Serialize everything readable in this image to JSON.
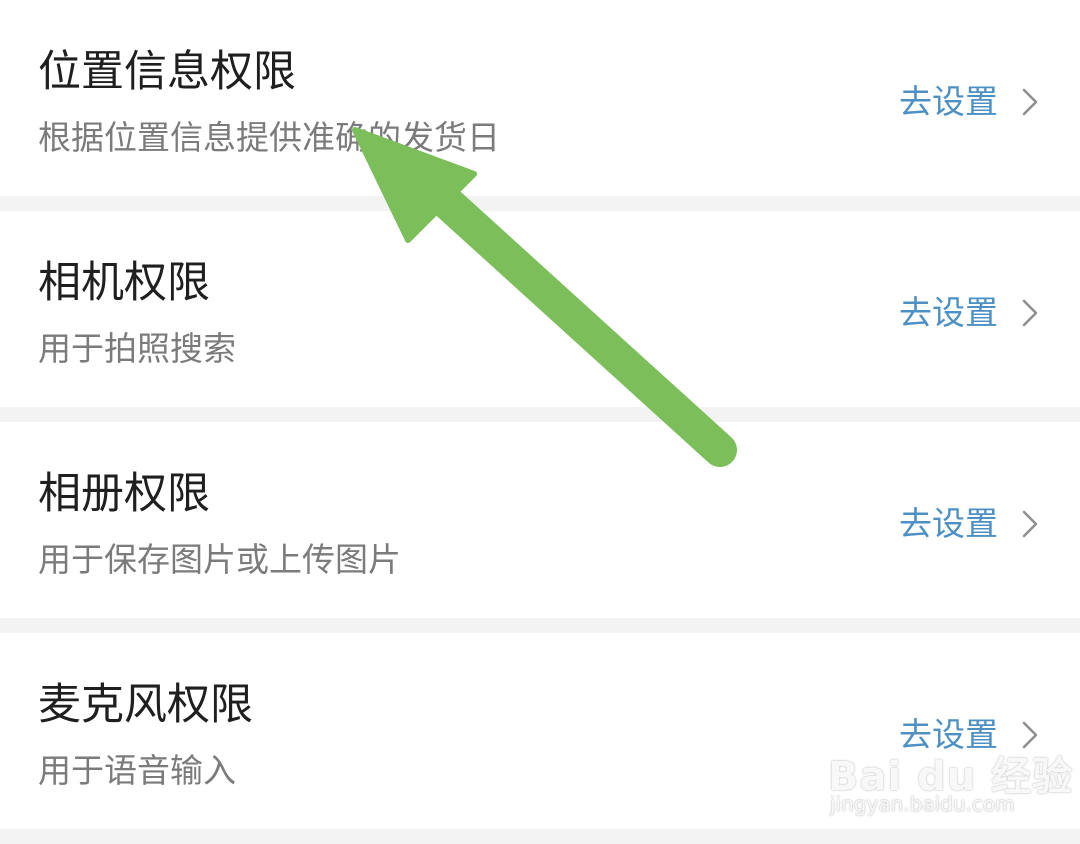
{
  "permissions": [
    {
      "title": "位置信息权限",
      "subtitle": "根据位置信息提供准确的发货日",
      "action": "去设置"
    },
    {
      "title": "相机权限",
      "subtitle": "用于拍照搜索",
      "action": "去设置"
    },
    {
      "title": "相册权限",
      "subtitle": "用于保存图片或上传图片",
      "action": "去设置"
    },
    {
      "title": "麦克风权限",
      "subtitle": "用于语音输入",
      "action": "去设置"
    }
  ],
  "icons": {
    "chevron": "chevron-right-icon",
    "annotation": "arrow-annotation"
  },
  "colors": {
    "action": "#4c90c4",
    "arrow": "#7cbf5a",
    "background": "#f3f3f3"
  },
  "watermark": {
    "logo": "Bai du 经验",
    "url": "jingyan.baidu.com"
  }
}
